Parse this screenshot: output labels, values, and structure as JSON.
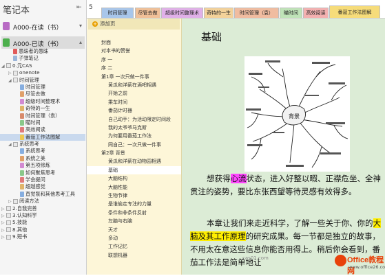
{
  "notebook_panel": {
    "title": "笔记本",
    "notebooks": [
      {
        "label": "A000-在读（书）",
        "color": "#b86bc4"
      },
      {
        "label": "A000-已读（书）",
        "color": "#4caf4c"
      }
    ],
    "tree": [
      {
        "label": "愚昧者的愚昧",
        "depth": 1,
        "kind": "section",
        "color": "#e05a5a"
      },
      {
        "label": "子弹笔记",
        "depth": 1,
        "kind": "section",
        "color": "#9ab5d9"
      },
      {
        "label": "0.元CAS",
        "depth": 0,
        "kind": "group",
        "open": true
      },
      {
        "label": "onenote",
        "depth": 1,
        "kind": "group",
        "open": false
      },
      {
        "label": "时间管理",
        "depth": 1,
        "kind": "group",
        "open": true
      },
      {
        "label": "时间管理",
        "depth": 2,
        "kind": "section",
        "color": "#86aee0"
      },
      {
        "label": "尽管去做",
        "depth": 2,
        "kind": "section",
        "color": "#e0a06a"
      },
      {
        "label": "超级时间整理术",
        "depth": 2,
        "kind": "section",
        "color": "#d28ad2"
      },
      {
        "label": "奇特的一生",
        "depth": 2,
        "kind": "section",
        "color": "#e0b46a"
      },
      {
        "label": "时间管理（袁）",
        "depth": 2,
        "kind": "section",
        "color": "#d88a6a"
      },
      {
        "label": "瞄时间",
        "depth": 2,
        "kind": "section",
        "color": "#8ac88a"
      },
      {
        "label": "高效阅读",
        "depth": 2,
        "kind": "section",
        "color": "#e07a7a"
      },
      {
        "label": "番茄工作法图解",
        "depth": 2,
        "kind": "section",
        "color": "#eec850",
        "selected": true
      },
      {
        "label": "系统思考",
        "depth": 1,
        "kind": "group",
        "open": true
      },
      {
        "label": "系统思考",
        "depth": 2,
        "kind": "section",
        "color": "#86aee0"
      },
      {
        "label": "系统之美",
        "depth": 2,
        "kind": "section",
        "color": "#e0a06a"
      },
      {
        "label": "第五项修炼",
        "depth": 2,
        "kind": "section",
        "color": "#d28ad2"
      },
      {
        "label": "如何聚焦思考",
        "depth": 2,
        "kind": "section",
        "color": "#8ac88a"
      },
      {
        "label": "学会提问",
        "depth": 2,
        "kind": "section",
        "color": "#e07a7a"
      },
      {
        "label": "超越感觉",
        "depth": 2,
        "kind": "section",
        "color": "#e0b46a"
      },
      {
        "label": "直觉泵和其他思考工具",
        "depth": 2,
        "kind": "section",
        "color": "#86aee0"
      },
      {
        "label": "阅读方法",
        "depth": 1,
        "kind": "group",
        "open": false
      },
      {
        "label": "2.自我完善",
        "depth": 0,
        "kind": "group",
        "open": false
      },
      {
        "label": "3.认知科学",
        "depth": 0,
        "kind": "group",
        "open": false
      },
      {
        "label": "5.技能",
        "depth": 0,
        "kind": "group",
        "open": false
      },
      {
        "label": "8.其他",
        "depth": 0,
        "kind": "group",
        "open": false
      },
      {
        "label": "9.短书",
        "depth": 0,
        "kind": "group",
        "open": false
      }
    ]
  },
  "tabs": {
    "number": "5",
    "items": [
      {
        "label": "时间管理",
        "color": "#a8c6ea"
      },
      {
        "label": "尽管去做",
        "color": "#f0c098"
      },
      {
        "label": "超级时间整理术",
        "color": "#e0b0e8"
      },
      {
        "label": "奇特的一生",
        "color": "#f3d29a"
      },
      {
        "label": "时间管理（袁）",
        "color": "#f0bca0"
      },
      {
        "label": "瞄时间",
        "color": "#bfe3b8"
      },
      {
        "label": "高效阅读",
        "color": "#f3b0b0"
      },
      {
        "label": "番茄工作法图解",
        "color": "#f6dc7a",
        "active": true
      }
    ]
  },
  "page_list": {
    "add_label": "添加页",
    "items": [
      {
        "label": "封面",
        "indent": 1
      },
      {
        "label": "对本书的赞誉",
        "indent": 1
      },
      {
        "label": "序 一",
        "indent": 1
      },
      {
        "label": "序 二",
        "indent": 1
      },
      {
        "label": "第1章 一次只做一件事",
        "indent": 1
      },
      {
        "label": "黄瓜和洋蓟在酒吧相遇",
        "indent": 2
      },
      {
        "label": "开始之前",
        "indent": 2
      },
      {
        "label": "乘车时间",
        "indent": 2
      },
      {
        "label": "番茄计时器",
        "indent": 2
      },
      {
        "label": "自己动手：为活动限定时间段",
        "indent": 2
      },
      {
        "label": "我的太爷爷马克斯",
        "indent": 2
      },
      {
        "label": "为何要用番茄工作法",
        "indent": 2
      },
      {
        "label": "同自己：一次只做一件事",
        "indent": 2
      },
      {
        "label": "第2章 背景",
        "indent": 1
      },
      {
        "label": "黄瓜和洋蓟在动物园相遇",
        "indent": 2
      },
      {
        "label": "基础",
        "indent": 2,
        "selected": true
      },
      {
        "label": "大脑结构",
        "indent": 2
      },
      {
        "label": "大脑性能",
        "indent": 2
      },
      {
        "label": "生物节律",
        "indent": 2
      },
      {
        "label": "是谁偷走专注的力量",
        "indent": 2
      },
      {
        "label": "条件和非条件反射",
        "indent": 2
      },
      {
        "label": "左脑与右脑",
        "indent": 2
      },
      {
        "label": "天才",
        "indent": 2
      },
      {
        "label": "多动",
        "indent": 2
      },
      {
        "label": "工作记忆",
        "indent": 2
      },
      {
        "label": "联想机器",
        "indent": 2
      }
    ]
  },
  "page": {
    "title": "基础",
    "mindmap_center": "背景",
    "p1": {
      "a": "想获得",
      "hl": "心流",
      "b": "状态，进入好整以暇、正襟危坐、全神贯注的姿势，要比东张西望等待灵感有效得多。"
    },
    "p2": {
      "a": "本章让我们来走近科学，了解一些关于你、你的",
      "hl": "大脑及其工作原理",
      "b": "的研究成果。每一节都是独立的故事，不用太在意这些信息你能否用得上。稍后你会看到，番茄工作法是简单地让"
    }
  },
  "watermark": "cas01.com",
  "logo": {
    "brand": "Office教程网",
    "url": "www.office26.com"
  },
  "colors": {
    "highlight_magenta": "#ff44ff",
    "highlight_yellow": "#ffee00",
    "content_bg": "#dcecd6",
    "pagelist_bg": "#fdf6d8"
  }
}
